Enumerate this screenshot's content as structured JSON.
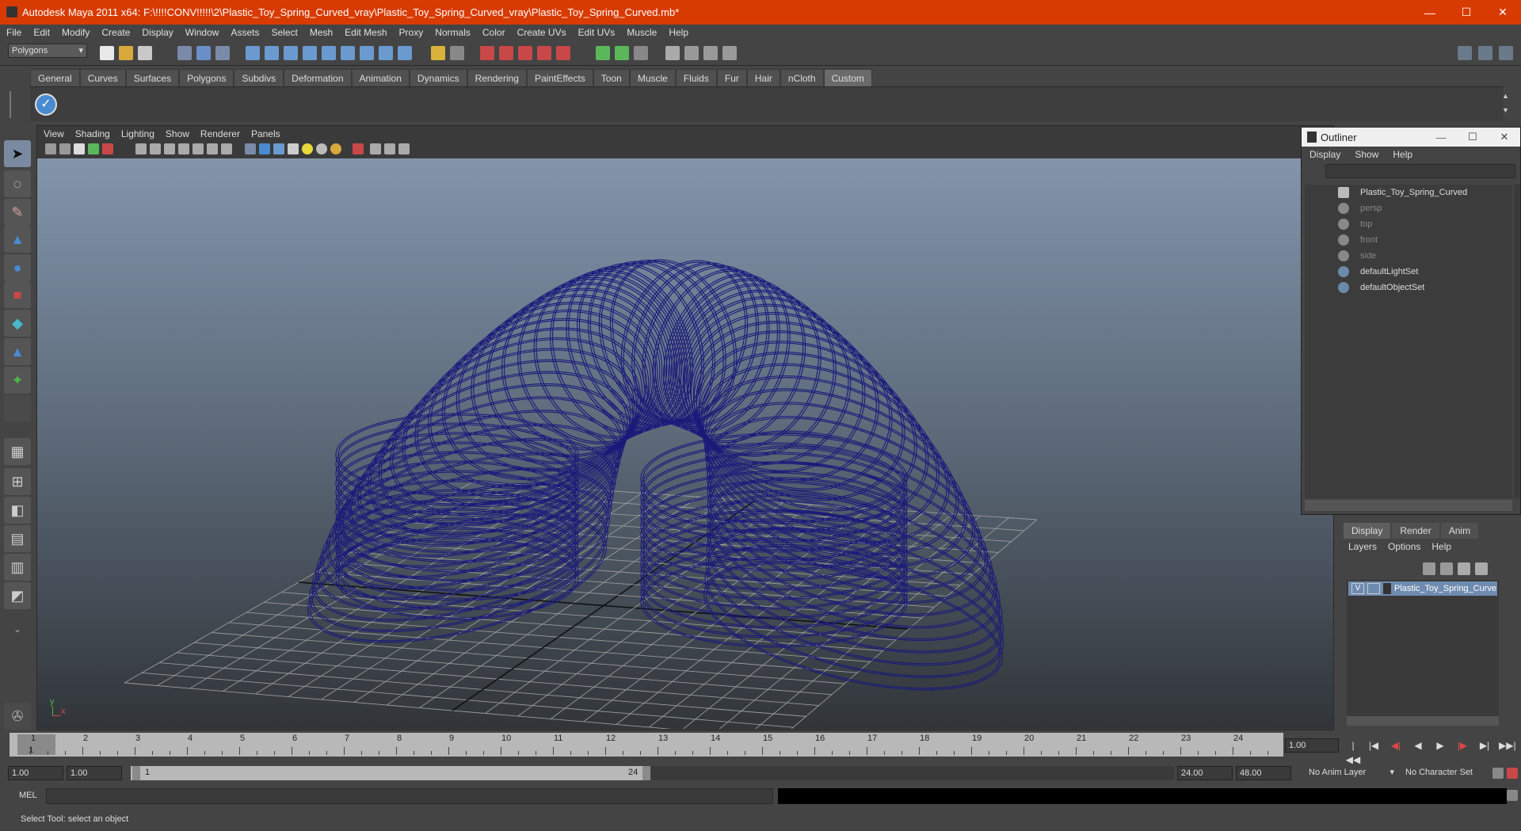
{
  "window": {
    "title": "Autodesk Maya 2011 x64: F:\\!!!!CONV!!!!!\\2\\Plastic_Toy_Spring_Curved_vray\\Plastic_Toy_Spring_Curved_vray\\Plastic_Toy_Spring_Curved.mb*",
    "minimize": "—",
    "maximize": "☐",
    "close": "✕"
  },
  "menubar": [
    "File",
    "Edit",
    "Modify",
    "Create",
    "Display",
    "Window",
    "Assets",
    "Select",
    "Mesh",
    "Edit Mesh",
    "Proxy",
    "Normals",
    "Color",
    "Create UVs",
    "Edit UVs",
    "Muscle",
    "Help"
  ],
  "statusline": {
    "mode": "Polygons"
  },
  "shelf": {
    "tabs": [
      "General",
      "Curves",
      "Surfaces",
      "Polygons",
      "Subdivs",
      "Deformation",
      "Animation",
      "Dynamics",
      "Rendering",
      "PaintEffects",
      "Toon",
      "Muscle",
      "Fluids",
      "Fur",
      "Hair",
      "nCloth",
      "Custom"
    ],
    "active_tab": "Custom"
  },
  "viewport": {
    "menu": [
      "View",
      "Shading",
      "Lighting",
      "Show",
      "Renderer",
      "Panels"
    ],
    "axis_y": "y",
    "axis_x": "x",
    "wire_color": "#1a1a7a"
  },
  "outliner": {
    "title": "Outliner",
    "menu": [
      "Display",
      "Show",
      "Help"
    ],
    "items": [
      {
        "label": "Plastic_Toy_Spring_Curved"
      },
      {
        "label": "persp"
      },
      {
        "label": "top"
      },
      {
        "label": "front"
      },
      {
        "label": "side"
      },
      {
        "label": "defaultLightSet"
      },
      {
        "label": "defaultObjectSet"
      }
    ]
  },
  "layers": {
    "tabs": [
      "Display",
      "Render",
      "Anim"
    ],
    "menu": [
      "Layers",
      "Options",
      "Help"
    ],
    "visible_flag": "V",
    "layer_name": "Plastic_Toy_Spring_Curve"
  },
  "timeline": {
    "ticks": [
      "1",
      "2",
      "3",
      "4",
      "5",
      "6",
      "7",
      "8",
      "9",
      "10",
      "11",
      "12",
      "13",
      "14",
      "15",
      "16",
      "17",
      "18",
      "19",
      "20",
      "21",
      "22",
      "23",
      "24"
    ],
    "current_frame": "1",
    "current_field": "1.00"
  },
  "playback": [
    "|◀◀",
    "|◀",
    "◀|",
    "◀",
    "▶",
    "|▶",
    "▶|",
    "▶▶|"
  ],
  "range": {
    "start": "1.00",
    "start2": "1.00",
    "slider_start": "1",
    "slider_end": "24",
    "end": "24.00",
    "end2": "48.00",
    "anim_layer": "No Anim Layer",
    "char_set": "No Character Set"
  },
  "cmdline": {
    "label": "MEL"
  },
  "statusbar": {
    "text": "Select Tool: select an object"
  }
}
